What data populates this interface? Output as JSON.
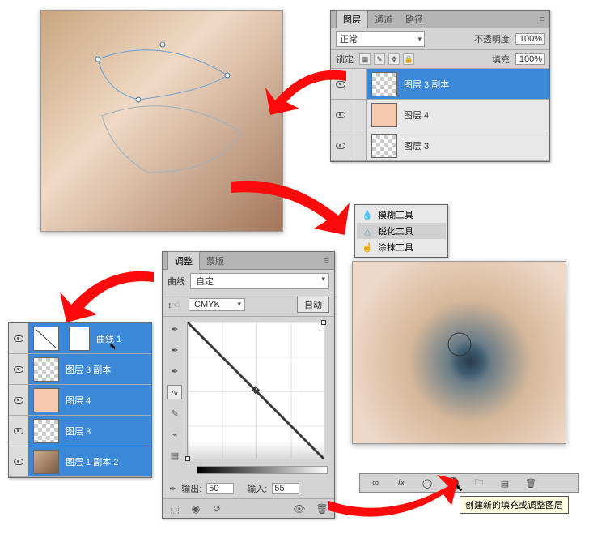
{
  "layers_panel": {
    "tabs": [
      "图层",
      "通道",
      "路径"
    ],
    "blend_mode": "正常",
    "opacity_label": "不透明度:",
    "opacity_value": "100%",
    "lock_label": "锁定:",
    "fill_label": "填充:",
    "fill_value": "100%",
    "rows": [
      {
        "name": "图层 3 副本",
        "selected": true,
        "thumb": "checker"
      },
      {
        "name": "图层 4",
        "selected": false,
        "thumb": "skin"
      },
      {
        "name": "图层 3",
        "selected": false,
        "thumb": "checker"
      }
    ]
  },
  "left_layers_panel": {
    "rows": [
      {
        "name": "曲线 1",
        "thumb": "curve"
      },
      {
        "name": "图层 3 副本",
        "thumb": "checker"
      },
      {
        "name": "图层 4",
        "thumb": "skin"
      },
      {
        "name": "图层 3",
        "thumb": "checker"
      },
      {
        "name": "图层 1 副本 2",
        "thumb": "photo"
      }
    ]
  },
  "tool_flyout": {
    "items": [
      {
        "label": "模糊工具",
        "icon": "drop"
      },
      {
        "label": "锐化工具",
        "icon": "tri",
        "selected": true
      },
      {
        "label": "涂抹工具",
        "icon": "finger"
      }
    ]
  },
  "curves_panel": {
    "tabs": [
      "调整",
      "蒙版"
    ],
    "title": "曲线",
    "preset": "自定",
    "channel": "CMYK",
    "auto_btn": "自动",
    "output_label": "输出:",
    "output_value": "50",
    "input_label": "输入:",
    "input_value": "55",
    "tooltip": "创建新的填充或调整图层"
  },
  "chart_data": {
    "type": "line",
    "title": "Curves",
    "xlabel": "输入",
    "ylabel": "输出",
    "xlim": [
      0,
      255
    ],
    "ylim": [
      0,
      255
    ],
    "series": [
      {
        "name": "CMYK",
        "x": [
          0,
          55,
          255
        ],
        "y": [
          0,
          50,
          255
        ]
      }
    ],
    "selected_point": {
      "input": 55,
      "output": 50
    }
  }
}
